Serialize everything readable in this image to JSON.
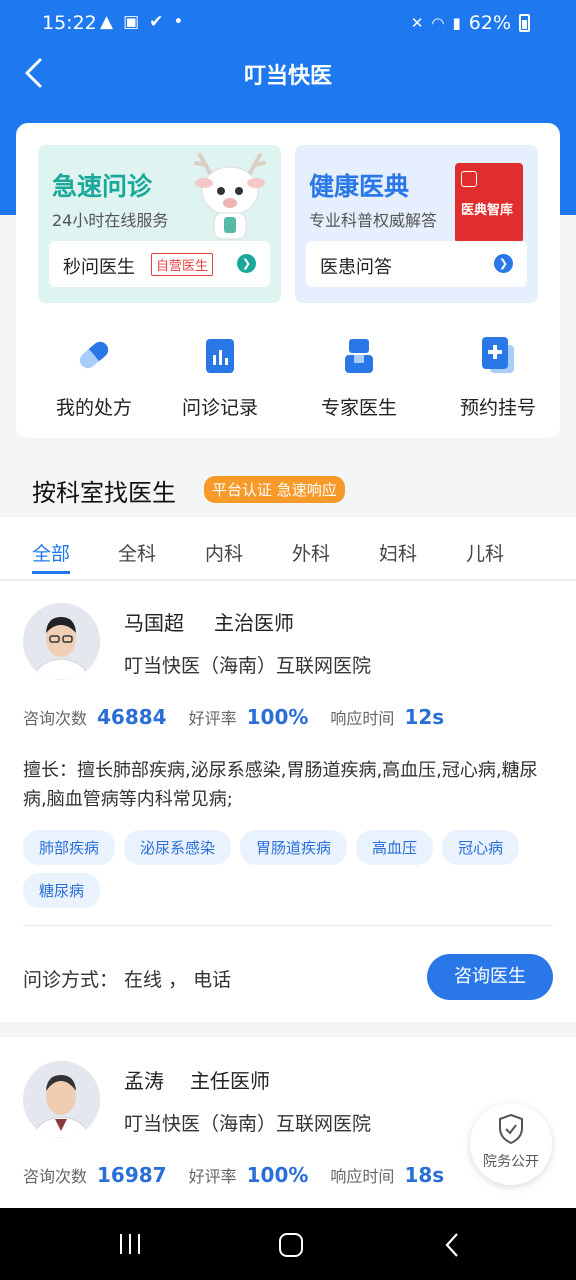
{
  "status_bar": {
    "time": "15:22",
    "battery": "62%"
  },
  "header": {
    "title": "叮当快医"
  },
  "promos": {
    "left": {
      "title": "急速问诊",
      "subtitle": "24小时在线服务",
      "bar_label": "秒问医生",
      "tag": "自营医生"
    },
    "right": {
      "title": "健康医典",
      "subtitle": "专业科普权威解答",
      "bar_label": "医患问答",
      "book_label": "医典智库"
    }
  },
  "quick_actions": [
    {
      "label": "我的处方",
      "icon": "pill-icon"
    },
    {
      "label": "问诊记录",
      "icon": "chart-doc-icon"
    },
    {
      "label": "专家医生",
      "icon": "doctor-icon"
    },
    {
      "label": "预约挂号",
      "icon": "add-doc-icon"
    }
  ],
  "section": {
    "title": "按科室找医生",
    "badge": "平台认证 急速响应"
  },
  "tabs": [
    "全部",
    "全科",
    "内科",
    "外科",
    "妇科",
    "儿科"
  ],
  "active_tab": "全部",
  "doctors": [
    {
      "name": "马国超",
      "title": "主治医师",
      "hospital": "叮当快医（海南）互联网医院",
      "consult_label": "咨询次数",
      "consult_count": "46884",
      "rating_label": "好评率",
      "rating": "100%",
      "response_label": "响应时间",
      "response": "12s",
      "expertise": "擅长：擅长肺部疾病,泌尿系感染,胃肠道疾病,高血压,冠心病,糖尿病,脑血管病等内科常见病;",
      "tags": [
        "肺部疾病",
        "泌尿系感染",
        "胃肠道疾病",
        "高血压",
        "冠心病",
        "糖尿病"
      ],
      "mode": "问诊方式：  在线 ，  电话",
      "button": "咨询医生"
    },
    {
      "name": "孟涛",
      "title": "主任医师",
      "hospital": "叮当快医（海南）互联网医院",
      "consult_label": "咨询次数",
      "consult_count": "16987",
      "rating_label": "好评率",
      "rating": "100%",
      "response_label": "响应时间",
      "response": "18s"
    }
  ],
  "float_badge": {
    "label": "院务公开"
  },
  "colors": {
    "primary": "#1e78f0",
    "teal": "#19a89a",
    "orange": "#f79a2a",
    "red": "#e02d2d"
  }
}
